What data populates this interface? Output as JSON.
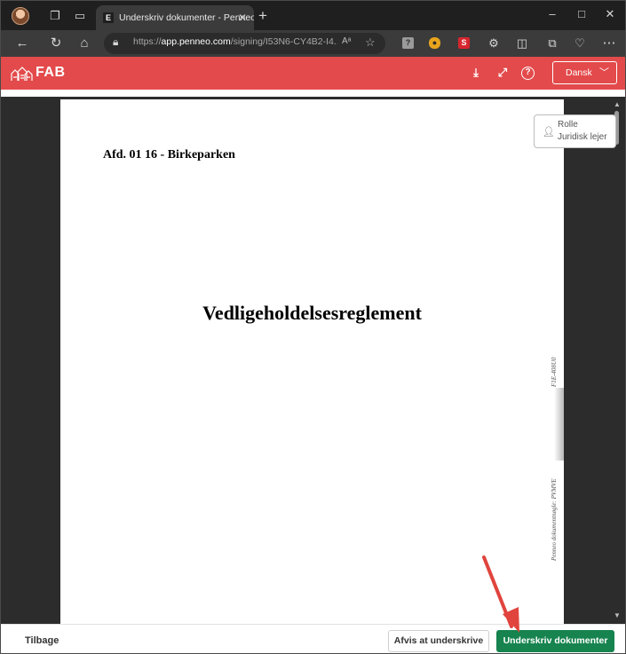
{
  "browser": {
    "tab_title": "Underskriv dokumenter - Penneo",
    "tab_favicon_letter": "E",
    "tab_close": "✕",
    "new_tab": "+",
    "url_prefix": "https://",
    "url_host": "app.penneo.com",
    "url_path": "/signing/I53N6-CY4B2-I4...",
    "read_aloud": "Aᵃ",
    "window_controls": [
      "–",
      "□",
      "✕"
    ]
  },
  "app": {
    "brand": "FAB",
    "language": "Dansk",
    "accent_color": "#e34a4b"
  },
  "document": {
    "heading": "Afd. 01 16 - Birkeparken",
    "title": "Vedligeholdelsesreglement",
    "margin_top": "F1E-408U0",
    "margin_bottom": "Penneo dokumentnøgle: PVMVE"
  },
  "role": {
    "label": "Rolle",
    "value": "Juridisk lejer"
  },
  "footer": {
    "back_label": "Tilbage",
    "reject_label": "Afvis at underskrive",
    "sign_label": "Underskriv dokumenter",
    "sign_color": "#17834f"
  }
}
